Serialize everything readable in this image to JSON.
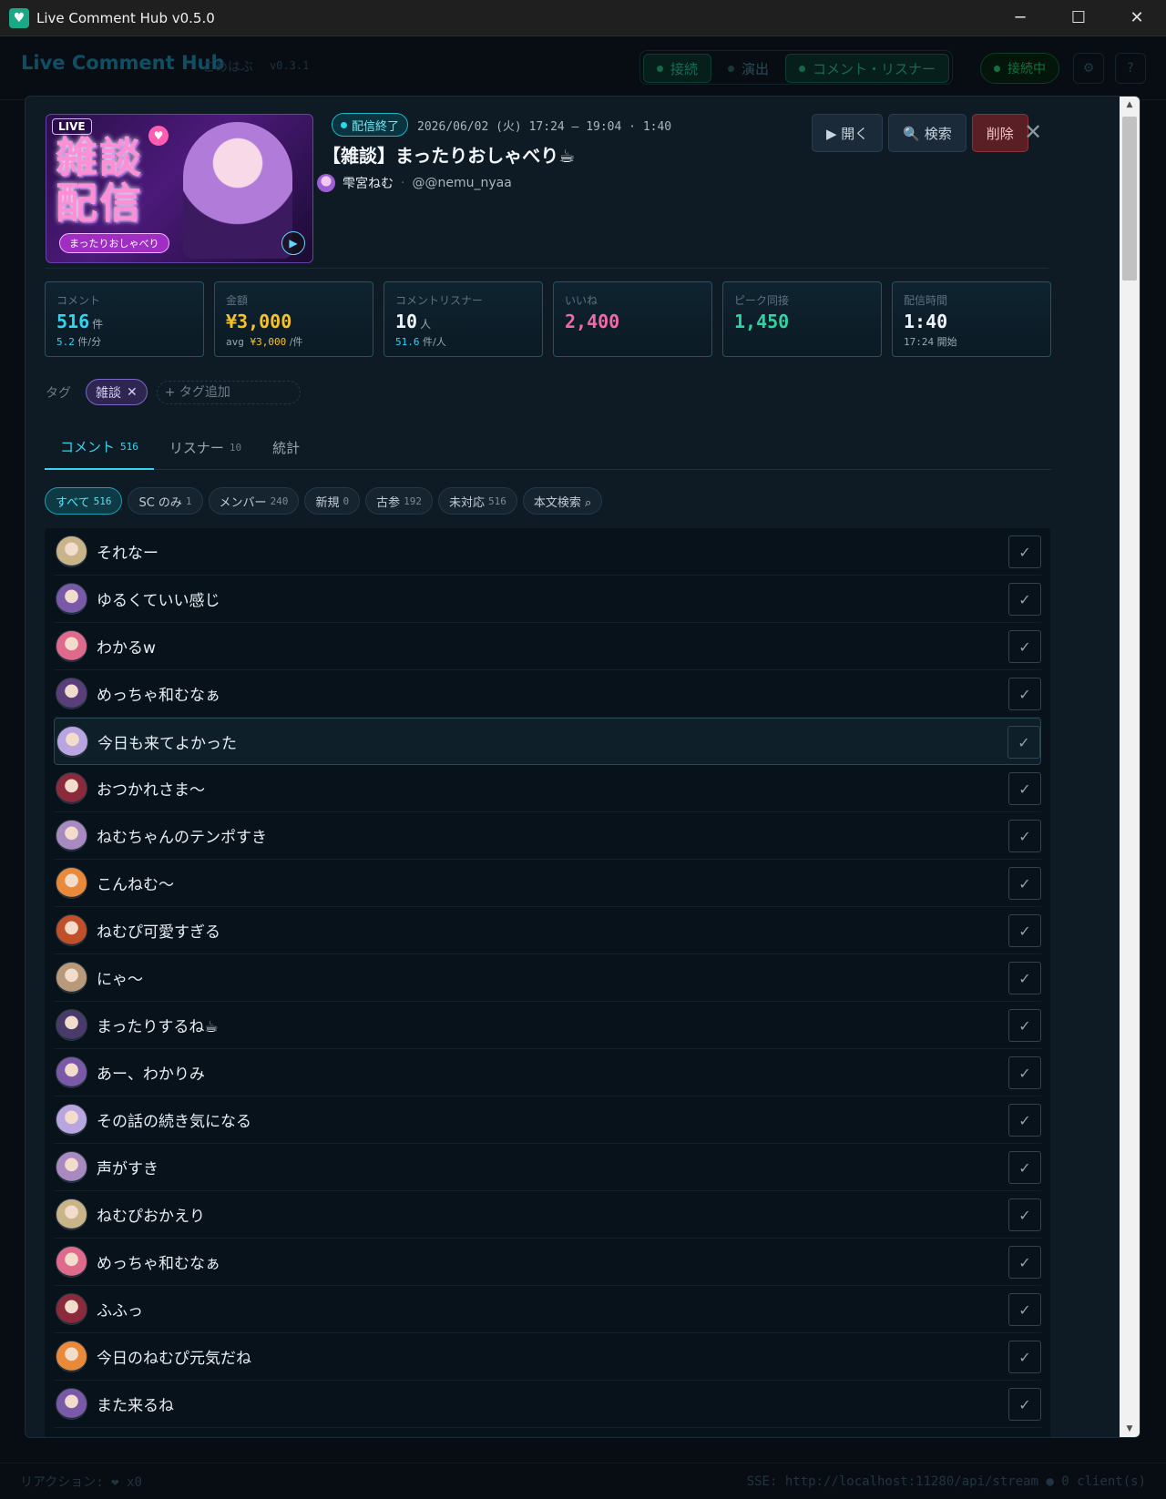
{
  "window": {
    "title": "Live Comment Hub v0.5.0",
    "minimize": "─",
    "maximize": "☐",
    "close": "✕"
  },
  "bg": {
    "brand": "Live Comment Hub",
    "brand_sub": "こめはぶ",
    "version": "v0.3.1",
    "nav": [
      "接続",
      "演出",
      "コメント・リスナー"
    ],
    "status": "接続中",
    "settings_icon": "⚙",
    "help_icon": "?",
    "footer_left": "リアクション: ❤ x0",
    "footer_right": "SSE: http://localhost:11280/api/stream ● 0 client(s)"
  },
  "stream": {
    "thumbnail_live": "LIVE",
    "thumbnail_big": "雑談配信",
    "thumbnail_pill": "まったりおしゃべり",
    "status": "配信終了",
    "date": "2026/06/02 (火) 17:24 – 19:04 · 1:40",
    "title": "【雑談】まったりおしゃべり☕",
    "channel_name": "雫宮ねむ",
    "channel_sep": "·",
    "channel_handle": "@@nemu_nyaa"
  },
  "actions": {
    "open": "▶ 開く",
    "search": "🔍 検索",
    "delete": "削除",
    "close": "✕"
  },
  "stats": [
    {
      "label": "コメント",
      "value": "516",
      "unit": "件",
      "sub_num": "5.2",
      "sub_text": " 件/分",
      "color": "c-cyan"
    },
    {
      "label": "金額",
      "value": "¥3,000",
      "unit": "",
      "sub_pre": "avg ",
      "sub_num": "¥3,000",
      "sub_text": " /件",
      "color": "c-yellow"
    },
    {
      "label": "コメントリスナー",
      "value": "10",
      "unit": "人",
      "sub_num": "51.6",
      "sub_text": " 件/人",
      "color": "c-white"
    },
    {
      "label": "いいね",
      "value": "2,400",
      "unit": "",
      "sub_num": "",
      "sub_text": "",
      "color": "c-pink"
    },
    {
      "label": "ピーク同接",
      "value": "1,450",
      "unit": "",
      "sub_num": "",
      "sub_text": "",
      "color": "c-green"
    },
    {
      "label": "配信時間",
      "value": "1:40",
      "unit": "",
      "sub_num": "17:24",
      "sub_text": " 開始",
      "color": "c-white"
    }
  ],
  "tags": {
    "label": "タグ",
    "items": [
      "雑談"
    ],
    "add_placeholder": "+ タグ追加"
  },
  "tabs": [
    {
      "label": "コメント",
      "count": "516"
    },
    {
      "label": "リスナー",
      "count": "10"
    },
    {
      "label": "統計",
      "count": ""
    }
  ],
  "filters": [
    {
      "label": "すべて",
      "count": "516"
    },
    {
      "label": "SC のみ",
      "count": "1"
    },
    {
      "label": "メンバー",
      "count": "240"
    },
    {
      "label": "新規",
      "count": "0"
    },
    {
      "label": "古参",
      "count": "192"
    },
    {
      "label": "未対応",
      "count": "516"
    },
    {
      "label": "本文検索 ⌕",
      "count": ""
    }
  ],
  "comments": [
    {
      "text": "それなー",
      "avatar": "#c9b48a"
    },
    {
      "text": "ゆるくていい感じ",
      "avatar": "#7a5aa8"
    },
    {
      "text": "わかるw",
      "avatar": "#e06a8c"
    },
    {
      "text": "めっちゃ和むなぁ",
      "avatar": "#5a3e7a"
    },
    {
      "text": "今日も来てよかった",
      "avatar": "#b9a6e0"
    },
    {
      "text": "おつかれさま〜",
      "avatar": "#8a2a3a"
    },
    {
      "text": "ねむちゃんのテンポすき",
      "avatar": "#a88ac0"
    },
    {
      "text": "こんねむ〜",
      "avatar": "#e88a3a"
    },
    {
      "text": "ねむぴ可愛すぎる",
      "avatar": "#c0502a"
    },
    {
      "text": "にゃ〜",
      "avatar": "#b89a7a"
    },
    {
      "text": "まったりするね☕",
      "avatar": "#4a3a6a"
    },
    {
      "text": "あー、わかりみ",
      "avatar": "#7a5aa8"
    },
    {
      "text": "その話の続き気になる",
      "avatar": "#b9a6e0"
    },
    {
      "text": "声がすき",
      "avatar": "#a88ac0"
    },
    {
      "text": "ねむぴおかえり",
      "avatar": "#c9b48a"
    },
    {
      "text": "めっちゃ和むなぁ",
      "avatar": "#e06a8c"
    },
    {
      "text": "ふふっ",
      "avatar": "#8a2a3a"
    },
    {
      "text": "今日のねむぴ元気だね",
      "avatar": "#e88a3a"
    },
    {
      "text": "また来るね",
      "avatar": "#7a5aa8"
    }
  ],
  "check_icon": "✓",
  "scroll_up": "▲",
  "scroll_down": "▼"
}
